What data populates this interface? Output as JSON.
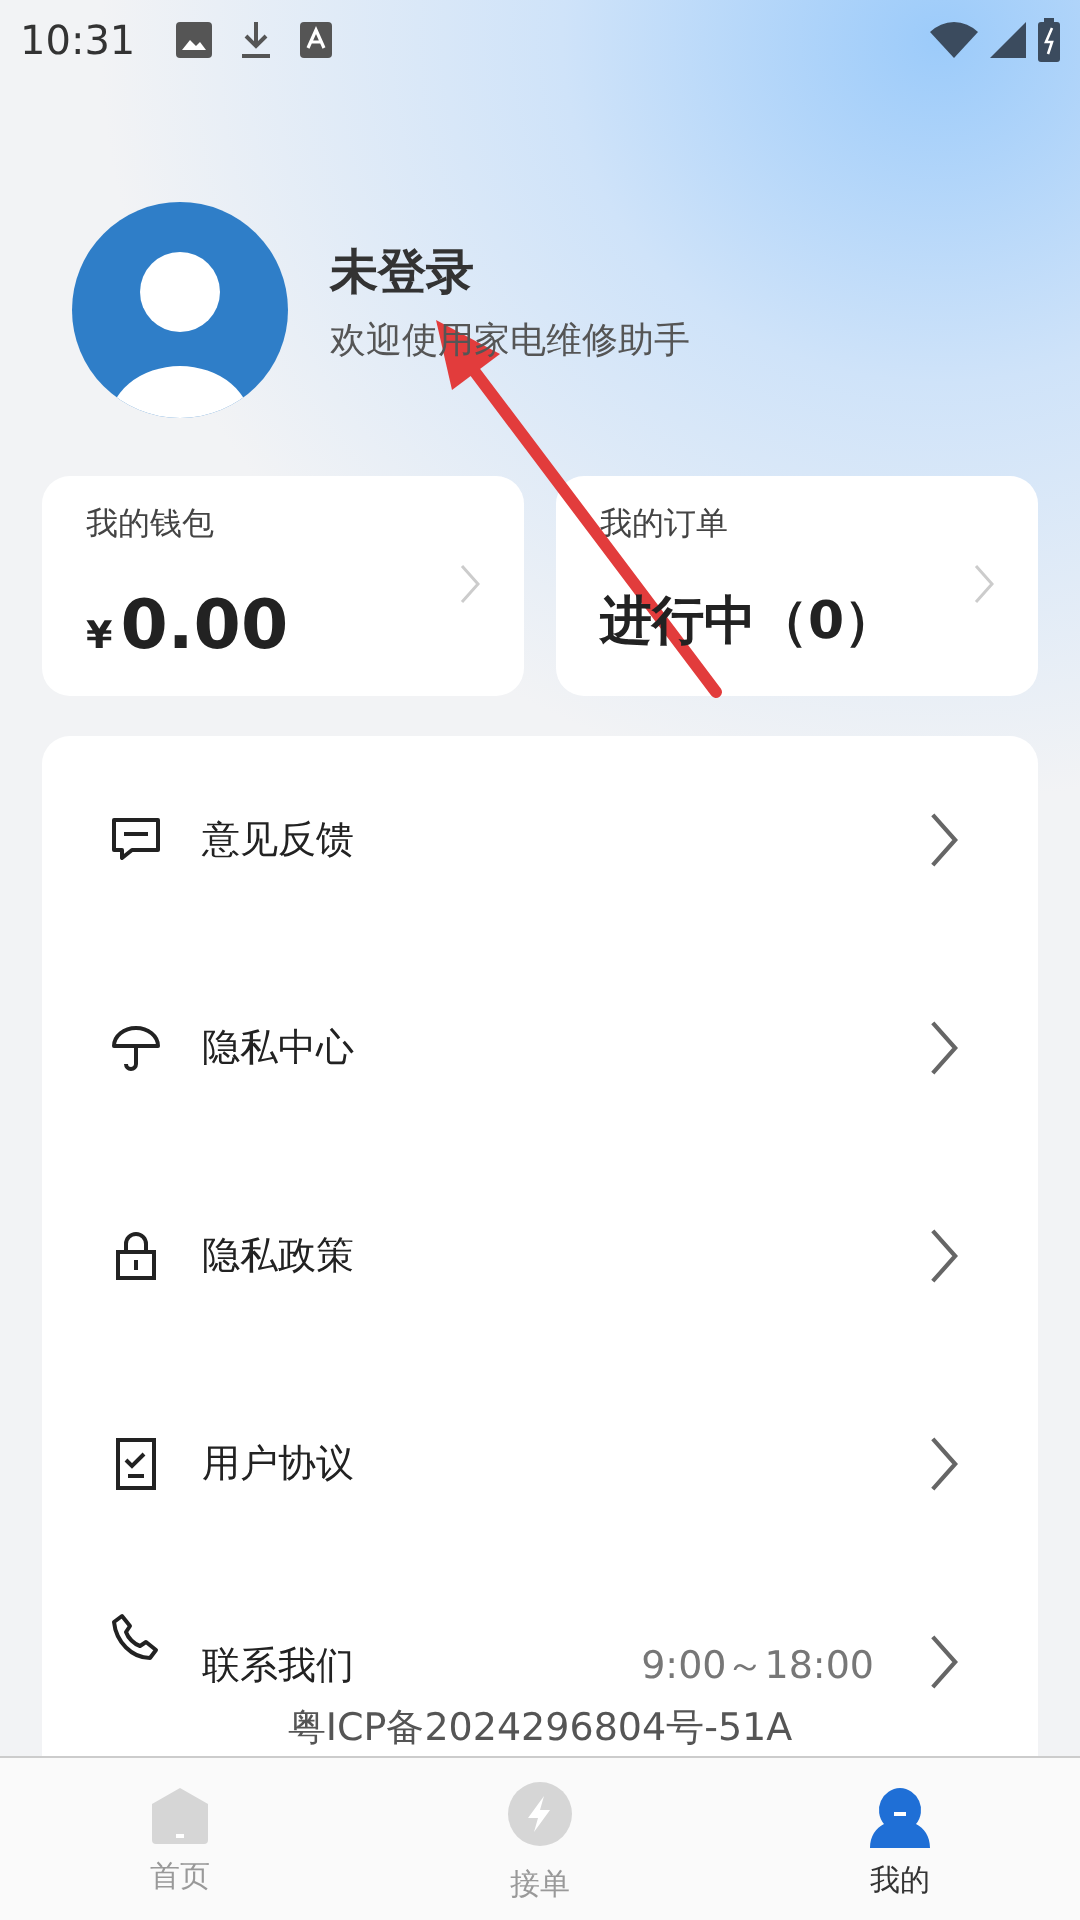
{
  "status_bar": {
    "time": "10:31"
  },
  "profile": {
    "name": "未登录",
    "subtitle": "欢迎使用家电维修助手"
  },
  "cards": [
    {
      "label": "我的钱包",
      "currency": "¥",
      "value": "0.00"
    },
    {
      "label": "我的订单",
      "value": "进行中（0）"
    }
  ],
  "menu": [
    {
      "kind": "feedback",
      "label": "意见反馈"
    },
    {
      "kind": "umbrella",
      "label": "隐私中心"
    },
    {
      "kind": "lock",
      "label": "隐私政策"
    },
    {
      "kind": "document",
      "label": "用户协议"
    },
    {
      "kind": "phone",
      "label": "联系我们",
      "note": "9:00～18:00"
    }
  ],
  "footer_note": "粤ICP备2024296804号-51A",
  "tabs": [
    {
      "kind": "home",
      "label": "首页",
      "selected": false
    },
    {
      "kind": "bolt",
      "label": "接单",
      "selected": false
    },
    {
      "kind": "person",
      "label": "我的",
      "selected": true
    }
  ]
}
